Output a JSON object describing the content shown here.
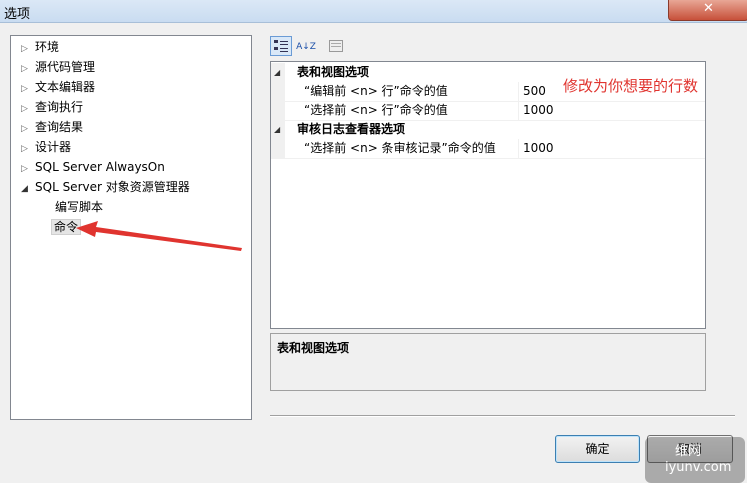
{
  "window": {
    "title": "选项",
    "close_label": "✕"
  },
  "tree": {
    "items": [
      {
        "label": "环境",
        "arrow": "▷"
      },
      {
        "label": "源代码管理",
        "arrow": "▷"
      },
      {
        "label": "文本编辑器",
        "arrow": "▷"
      },
      {
        "label": "查询执行",
        "arrow": "▷"
      },
      {
        "label": "查询结果",
        "arrow": "▷"
      },
      {
        "label": "设计器",
        "arrow": "▷"
      },
      {
        "label": "SQL Server AlwaysOn",
        "arrow": "▷"
      },
      {
        "label": "SQL Server 对象资源管理器",
        "arrow": "◢"
      },
      {
        "label": "编写脚本"
      },
      {
        "label": "命令"
      }
    ]
  },
  "toolbar": {
    "categorized_icon": "categorized-icon",
    "sort_label": "A↓Z",
    "pages_icon": "property-pages-icon"
  },
  "grid": {
    "categories": [
      {
        "name": "表和视图选项",
        "props": [
          {
            "name": "“编辑前 <n> 行”命令的值",
            "value": "500"
          },
          {
            "name": "“选择前 <n> 行”命令的值",
            "value": "1000"
          }
        ]
      },
      {
        "name": "审核日志查看器选项",
        "props": [
          {
            "name": "“选择前 <n> 条审核记录”命令的值",
            "value": "1000"
          }
        ]
      }
    ]
  },
  "annotation": "修改为你想要的行数",
  "description": {
    "title": "表和视图选项"
  },
  "buttons": {
    "ok": "确定",
    "cancel": "取消"
  },
  "watermark": {
    "line1": "维网",
    "line2": "iyunv.com"
  },
  "colors": {
    "annotation": "#e0342f",
    "arrow": "#e0342f"
  }
}
